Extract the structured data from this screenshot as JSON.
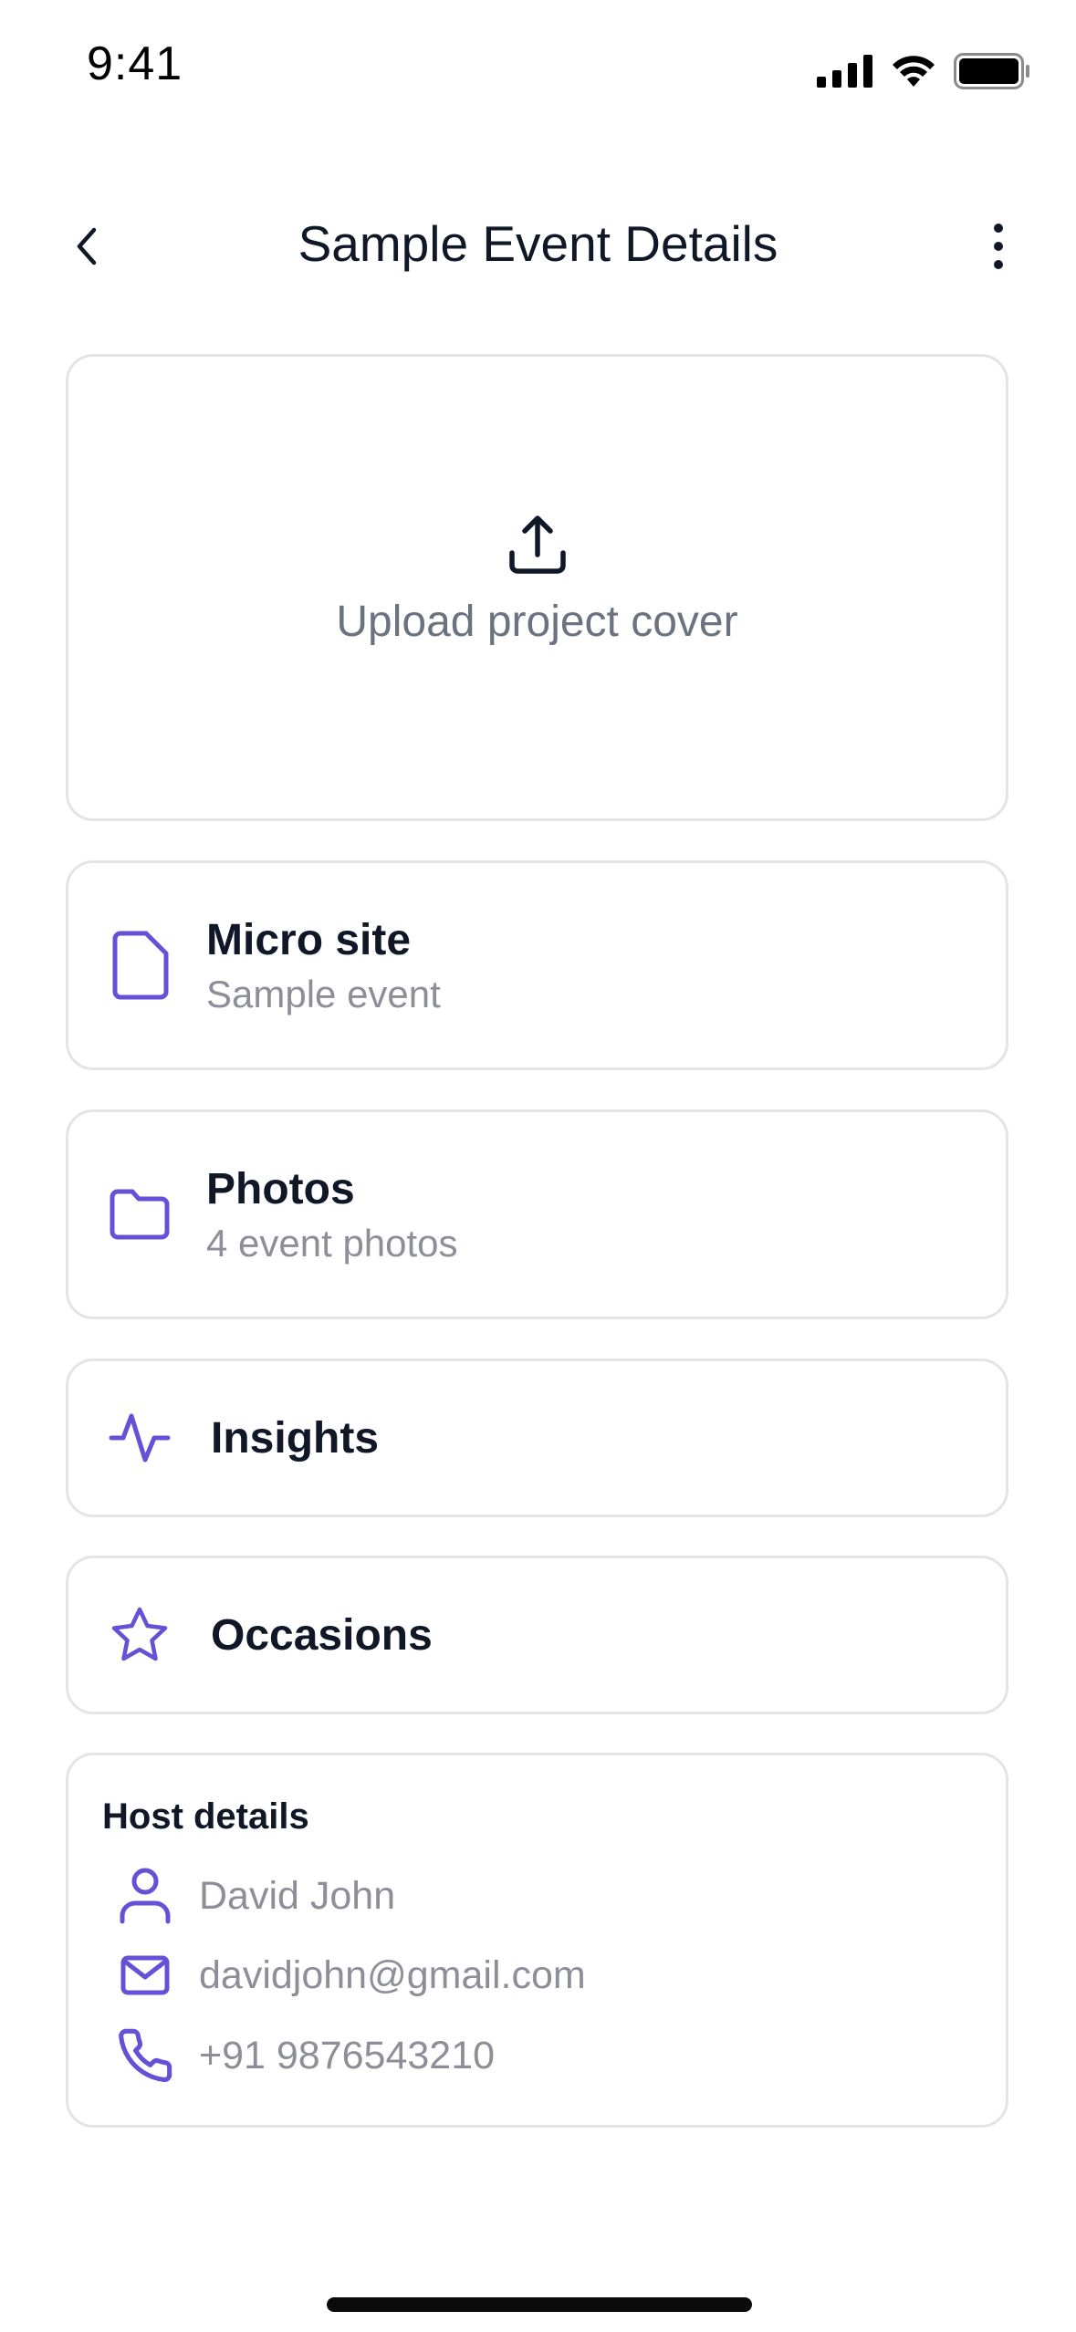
{
  "status_bar": {
    "time": "9:41",
    "icons": [
      "cellular-signal-icon",
      "wifi-icon",
      "battery-icon"
    ]
  },
  "nav": {
    "title": "Sample Event Details",
    "back_icon": "chevron-left-icon",
    "more_icon": "more-vertical-icon"
  },
  "upload": {
    "label": "Upload project cover",
    "icon": "upload-icon"
  },
  "items": [
    {
      "title": "Micro site",
      "subtitle": "Sample event",
      "icon": "file-icon"
    },
    {
      "title": "Photos",
      "subtitle": "4 event photos",
      "icon": "folder-icon"
    },
    {
      "title": "Insights",
      "icon": "activity-icon"
    },
    {
      "title": "Occasions",
      "icon": "star-icon"
    }
  ],
  "host": {
    "title": "Host details",
    "name": "David John",
    "email": "davidjohn@gmail.com",
    "phone": "+91 9876543210"
  },
  "colors": {
    "accent": "#6550d8",
    "text_primary": "#101828",
    "text_muted": "#8e8e99",
    "border": "#e4e4e7"
  }
}
